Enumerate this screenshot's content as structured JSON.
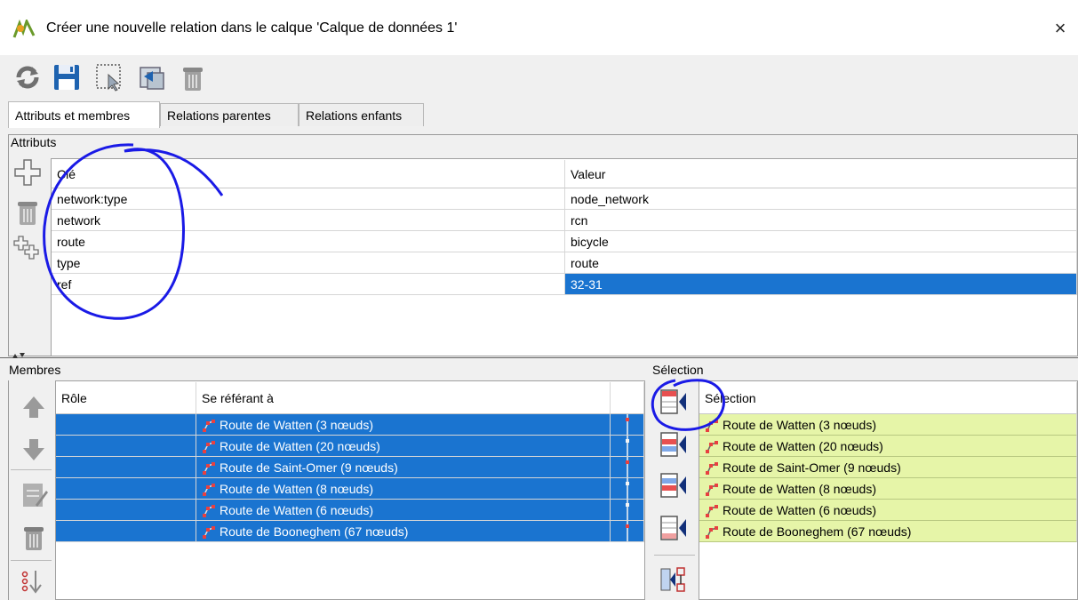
{
  "window": {
    "title": "Créer une nouvelle relation dans le calque 'Calque de données 1'",
    "close_glyph": "×"
  },
  "toolbar": {
    "buttons": [
      {
        "icon": "refresh-icon",
        "label": ""
      },
      {
        "icon": "save-icon",
        "label": ""
      },
      {
        "icon": "select-icon",
        "label": ""
      },
      {
        "icon": "revert-icon",
        "label": ""
      },
      {
        "icon": "delete-icon",
        "label": ""
      }
    ]
  },
  "tabs": [
    {
      "label": "Attributs et membres",
      "active": true
    },
    {
      "label": "Relations parentes",
      "active": false
    },
    {
      "label": "Relations enfants",
      "active": false
    }
  ],
  "attributes": {
    "section_label": "Attributs",
    "columns": {
      "key": "Clé",
      "value": "Valeur"
    },
    "rows": [
      {
        "key": "network:type",
        "value": "node_network"
      },
      {
        "key": "network",
        "value": "rcn"
      },
      {
        "key": "route",
        "value": "bicycle"
      },
      {
        "key": "type",
        "value": "route"
      },
      {
        "key": "ref",
        "value": "32-31"
      }
    ],
    "selected_value_row": 4
  },
  "members": {
    "section_label": "Membres",
    "columns": {
      "role": "Rôle",
      "ref": "Se référant à"
    },
    "rows": [
      {
        "role": "",
        "ref": "Route de Watten (3 nœuds)"
      },
      {
        "role": "",
        "ref": "Route de Watten (20 nœuds)"
      },
      {
        "role": "",
        "ref": "Route de Saint-Omer (9 nœuds)"
      },
      {
        "role": "",
        "ref": "Route de Watten (8 nœuds)"
      },
      {
        "role": "",
        "ref": "Route de Watten (6 nœuds)"
      },
      {
        "role": "",
        "ref": "Route de Booneghem (67 nœuds)"
      }
    ]
  },
  "selection": {
    "section_label": "Sélection",
    "column": "Sélection",
    "rows": [
      "Route de Watten (3 nœuds)",
      "Route de Watten (20 nœuds)",
      "Route de Saint-Omer (9 nœuds)",
      "Route de Watten (8 nœuds)",
      "Route de Watten (6 nœuds)",
      "Route de Booneghem (67 nœuds)"
    ]
  },
  "colors": {
    "selection_blue": "#1a74d0",
    "selection_green": "#e6f5a8",
    "annotation_blue": "#1a1ae6"
  }
}
